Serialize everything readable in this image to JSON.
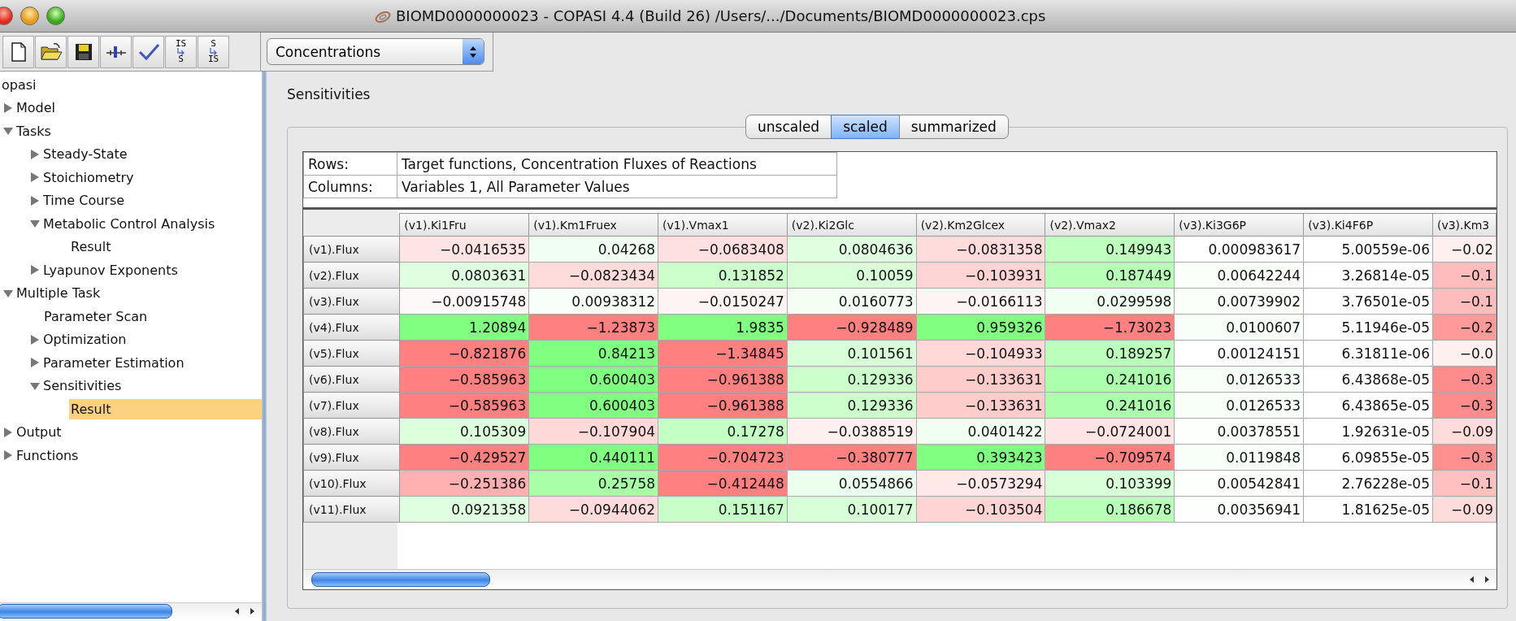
{
  "window": {
    "title": "BIOMD0000000023 - COPASI 4.4 (Build 26) /Users/.../Documents/BIOMD0000000023.cps"
  },
  "toolbar": [
    {
      "kind": "new"
    },
    {
      "kind": "open"
    },
    {
      "kind": "save"
    },
    {
      "kind": "commit"
    },
    {
      "kind": "check"
    },
    {
      "kind": "convert",
      "top": "IS",
      "bottom": "S"
    },
    {
      "kind": "convert",
      "top": "S",
      "bottom": "IS"
    }
  ],
  "mode_select": {
    "value": "Concentrations"
  },
  "tree": [
    {
      "label": "opasi",
      "kind": "leaf",
      "selected": false
    },
    {
      "label": "Model",
      "kind": "folder",
      "expanded": false,
      "selected": false
    },
    {
      "label": "Tasks",
      "kind": "folder",
      "expanded": true,
      "selected": false,
      "children": [
        {
          "label": "Steady-State",
          "kind": "folder",
          "expanded": false,
          "selected": false
        },
        {
          "label": "Stoichiometry",
          "kind": "folder",
          "expanded": false,
          "selected": false
        },
        {
          "label": "Time Course",
          "kind": "folder",
          "expanded": false,
          "selected": false
        },
        {
          "label": "Metabolic Control Analysis",
          "kind": "folder",
          "expanded": true,
          "selected": false,
          "children": [
            {
              "label": "Result",
              "kind": "leaf",
              "selected": false
            }
          ]
        },
        {
          "label": "Lyapunov Exponents",
          "kind": "folder",
          "expanded": false,
          "selected": false
        }
      ]
    },
    {
      "label": "Multiple Task",
      "kind": "folder",
      "expanded": true,
      "selected": false,
      "children": [
        {
          "label": "Parameter Scan",
          "kind": "leaf",
          "selected": false
        },
        {
          "label": "Optimization",
          "kind": "folder",
          "expanded": false,
          "selected": false
        },
        {
          "label": "Parameter Estimation",
          "kind": "folder",
          "expanded": false,
          "selected": false
        },
        {
          "label": "Sensitivities",
          "kind": "folder",
          "expanded": true,
          "selected": false,
          "children": [
            {
              "label": "Result",
              "kind": "leaf",
              "selected": true
            }
          ]
        }
      ]
    },
    {
      "label": "Output",
      "kind": "folder",
      "expanded": false,
      "selected": false
    },
    {
      "label": "Functions",
      "kind": "folder",
      "expanded": false,
      "selected": false
    }
  ],
  "panel": {
    "title": "Sensitivities"
  },
  "tabs": [
    {
      "label": "unscaled",
      "selected": false
    },
    {
      "label": "scaled",
      "selected": true
    },
    {
      "label": "summarized",
      "selected": false
    }
  ],
  "info": [
    {
      "label": "Rows:",
      "value": "Target functions, Concentration Fluxes of Reactions"
    },
    {
      "label": "Columns:",
      "value": "Variables 1, All Parameter Values"
    }
  ],
  "table": {
    "columns": [
      "(v1).Ki1Fru",
      "(v1).Km1Fruex",
      "(v1).Vmax1",
      "(v2).Ki2Glc",
      "(v2).Km2Glcex",
      "(v2).Vmax2",
      "(v3).Ki3G6P",
      "(v3).Ki4F6P",
      "(v3).Km3"
    ],
    "rows": [
      {
        "label": "(v1).Flux",
        "cells": [
          {
            "value": "−0.0416535",
            "color": "#ffe4e4"
          },
          {
            "value": "0.04268",
            "color": "#f0fff0"
          },
          {
            "value": "−0.0683408",
            "color": "#ffe0e0"
          },
          {
            "value": "0.0804636",
            "color": "#e0ffe0"
          },
          {
            "value": "−0.0831358",
            "color": "#ffdcdc"
          },
          {
            "value": "0.149943",
            "color": "#c0ffc0"
          },
          {
            "value": "0.000983617",
            "color": "#ffffff"
          },
          {
            "value": "5.00559e-06",
            "color": "#ffffff"
          },
          {
            "value": "−0.02",
            "color": "#fff0f0"
          }
        ]
      },
      {
        "label": "(v2).Flux",
        "cells": [
          {
            "value": "0.0803631",
            "color": "#e0ffe0"
          },
          {
            "value": "−0.0823434",
            "color": "#ffdcdc"
          },
          {
            "value": "0.131852",
            "color": "#ccffcc"
          },
          {
            "value": "0.10059",
            "color": "#d8ffd8"
          },
          {
            "value": "−0.103931",
            "color": "#ffd4d4"
          },
          {
            "value": "0.187449",
            "color": "#b8ffb8"
          },
          {
            "value": "0.00642244",
            "color": "#fafffa"
          },
          {
            "value": "3.26814e-05",
            "color": "#ffffff"
          },
          {
            "value": "−0.1",
            "color": "#ffbcbc"
          }
        ]
      },
      {
        "label": "(v3).Flux",
        "cells": [
          {
            "value": "−0.00915748",
            "color": "#fff8f8"
          },
          {
            "value": "0.00938312",
            "color": "#f8fff8"
          },
          {
            "value": "−0.0150247",
            "color": "#fff4f4"
          },
          {
            "value": "0.0160773",
            "color": "#f4fff4"
          },
          {
            "value": "−0.0166113",
            "color": "#fff4f4"
          },
          {
            "value": "0.0299598",
            "color": "#f0fff0"
          },
          {
            "value": "0.00739902",
            "color": "#fafffa"
          },
          {
            "value": "3.76501e-05",
            "color": "#ffffff"
          },
          {
            "value": "−0.1",
            "color": "#ffbcbc"
          }
        ]
      },
      {
        "label": "(v4).Flux",
        "cells": [
          {
            "value": "1.20894",
            "color": "#80ff80"
          },
          {
            "value": "−1.23873",
            "color": "#ff8080"
          },
          {
            "value": "1.9835",
            "color": "#80ff80"
          },
          {
            "value": "−0.928489",
            "color": "#ff8080"
          },
          {
            "value": "0.959326",
            "color": "#80ff80"
          },
          {
            "value": "−1.73023",
            "color": "#ff8080"
          },
          {
            "value": "0.0100607",
            "color": "#f8fff8"
          },
          {
            "value": "5.11946e-05",
            "color": "#ffffff"
          },
          {
            "value": "−0.2",
            "color": "#ff9a9a"
          }
        ]
      },
      {
        "label": "(v5).Flux",
        "cells": [
          {
            "value": "−0.821876",
            "color": "#ff8080"
          },
          {
            "value": "0.84213",
            "color": "#80ff80"
          },
          {
            "value": "−1.34845",
            "color": "#ff8080"
          },
          {
            "value": "0.101561",
            "color": "#d8ffd8"
          },
          {
            "value": "−0.104933",
            "color": "#ffd8d8"
          },
          {
            "value": "0.189257",
            "color": "#bcffbc"
          },
          {
            "value": "0.00124151",
            "color": "#ffffff"
          },
          {
            "value": "6.31811e-06",
            "color": "#ffffff"
          },
          {
            "value": "−0.0",
            "color": "#fff0f0"
          }
        ]
      },
      {
        "label": "(v6).Flux",
        "cells": [
          {
            "value": "−0.585963",
            "color": "#ff8080"
          },
          {
            "value": "0.600403",
            "color": "#80ff80"
          },
          {
            "value": "−0.961388",
            "color": "#ff8080"
          },
          {
            "value": "0.129336",
            "color": "#ccffcc"
          },
          {
            "value": "−0.133631",
            "color": "#ffcccc"
          },
          {
            "value": "0.241016",
            "color": "#acffac"
          },
          {
            "value": "0.0126533",
            "color": "#f8fff8"
          },
          {
            "value": "6.43868e-05",
            "color": "#ffffff"
          },
          {
            "value": "−0.3",
            "color": "#ff8c8c"
          }
        ]
      },
      {
        "label": "(v7).Flux",
        "cells": [
          {
            "value": "−0.585963",
            "color": "#ff8080"
          },
          {
            "value": "0.600403",
            "color": "#80ff80"
          },
          {
            "value": "−0.961388",
            "color": "#ff8080"
          },
          {
            "value": "0.129336",
            "color": "#ccffcc"
          },
          {
            "value": "−0.133631",
            "color": "#ffcccc"
          },
          {
            "value": "0.241016",
            "color": "#acffac"
          },
          {
            "value": "0.0126533",
            "color": "#f8fff8"
          },
          {
            "value": "6.43865e-05",
            "color": "#ffffff"
          },
          {
            "value": "−0.3",
            "color": "#ff8c8c"
          }
        ]
      },
      {
        "label": "(v8).Flux",
        "cells": [
          {
            "value": "0.105309",
            "color": "#dcffdc"
          },
          {
            "value": "−0.107904",
            "color": "#ffd8d8"
          },
          {
            "value": "0.17278",
            "color": "#c4ffc4"
          },
          {
            "value": "−0.0388519",
            "color": "#fff0f0"
          },
          {
            "value": "0.0401422",
            "color": "#f0fff0"
          },
          {
            "value": "−0.0724001",
            "color": "#ffe4e4"
          },
          {
            "value": "0.00378551",
            "color": "#fcfffc"
          },
          {
            "value": "1.92631e-05",
            "color": "#ffffff"
          },
          {
            "value": "−0.09",
            "color": "#ffdcdc"
          }
        ]
      },
      {
        "label": "(v9).Flux",
        "cells": [
          {
            "value": "−0.429527",
            "color": "#ff8080"
          },
          {
            "value": "0.440111",
            "color": "#80ff80"
          },
          {
            "value": "−0.704723",
            "color": "#ff8080"
          },
          {
            "value": "−0.380777",
            "color": "#ff8080"
          },
          {
            "value": "0.393423",
            "color": "#80ff80"
          },
          {
            "value": "−0.709574",
            "color": "#ff8080"
          },
          {
            "value": "0.0119848",
            "color": "#f8fff8"
          },
          {
            "value": "6.09855e-05",
            "color": "#ffffff"
          },
          {
            "value": "−0.3",
            "color": "#ff9090"
          }
        ]
      },
      {
        "label": "(v10).Flux",
        "cells": [
          {
            "value": "−0.251386",
            "color": "#ffb0b0"
          },
          {
            "value": "0.25758",
            "color": "#a8ffa8"
          },
          {
            "value": "−0.412448",
            "color": "#ff8080"
          },
          {
            "value": "0.0554866",
            "color": "#ecffec"
          },
          {
            "value": "−0.0573294",
            "color": "#ffe8e8"
          },
          {
            "value": "0.103399",
            "color": "#d8ffd8"
          },
          {
            "value": "0.00542841",
            "color": "#fcfffc"
          },
          {
            "value": "2.76228e-05",
            "color": "#ffffff"
          },
          {
            "value": "−0.1",
            "color": "#ffc0c0"
          }
        ]
      },
      {
        "label": "(v11).Flux",
        "cells": [
          {
            "value": "0.0921358",
            "color": "#e0ffe0"
          },
          {
            "value": "−0.0944062",
            "color": "#ffdcdc"
          },
          {
            "value": "0.151167",
            "color": "#c8ffc8"
          },
          {
            "value": "0.100177",
            "color": "#d8ffd8"
          },
          {
            "value": "−0.103504",
            "color": "#ffd4d4"
          },
          {
            "value": "0.186678",
            "color": "#b8ffb8"
          },
          {
            "value": "0.00356941",
            "color": "#fcfffc"
          },
          {
            "value": "1.81625e-05",
            "color": "#ffffff"
          },
          {
            "value": "−0.09",
            "color": "#ffdcdc"
          }
        ]
      }
    ]
  }
}
